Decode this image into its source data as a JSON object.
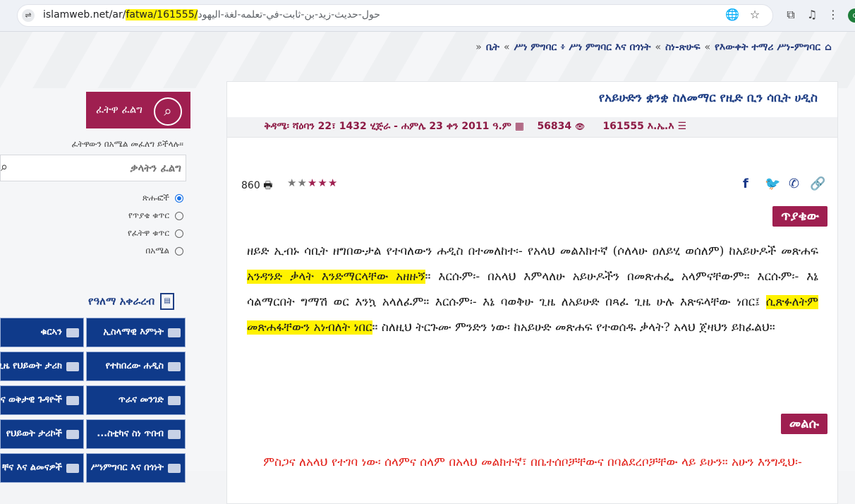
{
  "browser": {
    "url_prefix": "islamweb.net/ar/",
    "url_highlight": "fatwa/161555/",
    "url_slug": "حول-حديث-زيد-بن-ثابت-في-تعلمه-لغة-اليهود",
    "site_icon": "⇌",
    "translate_icon": "🌐",
    "bookmark_icon": "☆",
    "extensions_icon": "⧉",
    "menu_icon": "⋮",
    "profile_initial": "d"
  },
  "breadcrumb": {
    "items": [
      "ቤት",
      "ሥነ ምግባር ፥ ሥነ ምግባር እና በጎነት",
      "ስነ-ጽሁፍ",
      "የእውቀት ተማሪ ሥነ-ምግባር"
    ],
    "separator": "«",
    "home_icon": "⌂"
  },
  "sidebar": {
    "fatwa_button_label": "ፈትዋ ፈልግ",
    "fatwa_button_icon": "⌕",
    "note": "ፈትዋውን በአሜል መፈለግ ይችላሉ፡፡",
    "search_placeholder": "ቃላትን ፈልግ",
    "search_icon": "⌕",
    "radios": [
      {
        "label": "ጽሑፎች",
        "selected": true
      },
      {
        "label": "የጥያቄ ቁጥር",
        "selected": false
      },
      {
        "label": "የፈትዋ ቁጥር",
        "selected": false
      },
      {
        "label": "በአሜል",
        "selected": false
      }
    ],
    "calendar_link": "የዓለማ አቀራረብ",
    "calendar_icon": "📅",
    "categories": [
      {
        "label": "ኢስላማዊ እምነት"
      },
      {
        "label": "ቁርኣን"
      },
      {
        "label": "የተከበረው ሐዲስ"
      },
      {
        "label": "ጊዜ የህይወት ታሪክ"
      },
      {
        "label": "ጥራና መንገድ"
      },
      {
        "label": "ና ወቅታዊ ጉዳዮች"
      },
      {
        "label": "...ስቲካና ስነ ጥበብ"
      },
      {
        "label": "የህይወት ታሪኮች"
      },
      {
        "label": "ሥነምግባር እና በጎነት"
      },
      {
        "label": "ቸና እና ልመናዎች"
      }
    ]
  },
  "article": {
    "title": "የአይሁድን ቋንቋ ስለመማር የዚድ ቢን ሳቢት ሀዲስ",
    "date": "ቅዳሜ፡ ሻዕባን 22፣ 1432 ሂጅራ - ሐምሌ 23 ቀን 2011 ዓ.ም",
    "date_icon": "▦",
    "views": "56834",
    "views_icon": "👁",
    "fatwa_number": "161555 እ.ኤ.እ",
    "number_icon": "☰",
    "print_count": "860",
    "print_icon": "🖶",
    "rating": 3,
    "rating_max": 5,
    "share_icons": [
      "f",
      "🐦",
      "✆",
      "🔗"
    ],
    "question_label": "ጥያቄው",
    "question_parts": [
      {
        "text": "ዘይድ ኢብኑ ሳቢት ዘግበውታል የተባለውን ሐዲስ በተመለከተ፡- የአላህ መልእክተኛ (ሶለላሁ ዐለይሂ ወሰለም) ከአይሁዶች መጽሐፍ ",
        "hl": false
      },
      {
        "text": "አንዳንድ ቃላት እንድማርላቸው አዘዙኝ",
        "hl": true
      },
      {
        "text": "። እርሱም፡- በአላህ እምላለሁ አይሁዶችን በመጽሐፌ አላምናቸውም። እርሱም፡- እኔ ሳልማርበት ግማሽ ወር እንኳ አላለፈም። እርሱም፡- እኔ ባወቅሁ ጊዜ ለአይሁድ በጻፈ ጊዜ ሁሉ እጽፍላቸው ነበር፤ ",
        "hl": false
      },
      {
        "text": "ሲጽፉለትም መጽሐፋቸውን አነብለት ነበር",
        "hl": true
      },
      {
        "text": "። ስለዚህ ትርጉሙ ምንድን ነው፡ ከአይሁድ መጽሐፍ የተወሰዱ ቃላት? አላህ ጀዛህን ይክፈልህ።",
        "hl": false
      }
    ],
    "answer_label": "መልሱ",
    "answer_text": "ምስጋና ለአላህ የተገባ ነው፡ ሰላምና ሰላም በአላህ መልክተኛ፣ በቤተሰቦቻቸውና በባልደረቦቻቸው ላይ ይሁን። አሁን እንግዲህ፡-"
  }
}
